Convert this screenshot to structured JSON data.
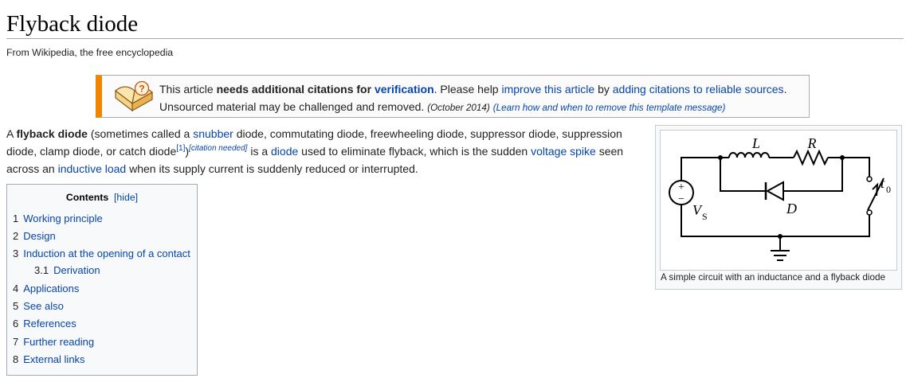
{
  "article": {
    "title": "Flyback diode",
    "site_sub": "From Wikipedia, the free encyclopedia"
  },
  "ambox": {
    "icon": "book-question-icon",
    "accent_color": "#f28500",
    "t1": "This article ",
    "t2": "needs additional citations for ",
    "t3": "verification",
    "t4": ". Please help ",
    "t5": "improve this article",
    "t6": " by ",
    "t7": "adding citations to reliable sources",
    "t8": ".",
    "t9": "Unsourced material may be challenged and removed.",
    "t10": "(October 2014)",
    "t11": "(Learn how and when to remove this template message)"
  },
  "lead": {
    "p1": "A ",
    "bold": "flyback diode",
    "p2": " (sometimes called a ",
    "l1": "snubber",
    "p3": " diode, commutating diode, freewheeling diode, suppressor diode, suppression diode, clamp diode, or catch diode",
    "ref1": "[1]",
    "p4": ")",
    "cn": "[citation needed]",
    "p5": " is a ",
    "l2": "diode",
    "p6": " used to eliminate flyback, which is the sudden ",
    "l3": "voltage spike",
    "p7": " seen across an ",
    "l4": "inductive load",
    "p8": " when its supply current is suddenly reduced or interrupted."
  },
  "toc": {
    "title": "Contents",
    "hide": "[hide]",
    "items": [
      {
        "num": "1",
        "label": "Working principle"
      },
      {
        "num": "2",
        "label": "Design"
      },
      {
        "num": "3",
        "label": "Induction at the opening of a contact"
      },
      {
        "num": "3.1",
        "label": "Derivation"
      },
      {
        "num": "4",
        "label": "Applications"
      },
      {
        "num": "5",
        "label": "See also"
      },
      {
        "num": "6",
        "label": "References"
      },
      {
        "num": "7",
        "label": "Further reading"
      },
      {
        "num": "8",
        "label": "External links"
      }
    ]
  },
  "figure": {
    "caption": "A simple circuit with an inductance and a flyback diode",
    "labels": {
      "L": "L",
      "R": "R",
      "D": "D",
      "V": "V",
      "V_sub": "S",
      "t": "t",
      "t_sub": "0",
      "plus": "+",
      "minus": "−"
    }
  }
}
